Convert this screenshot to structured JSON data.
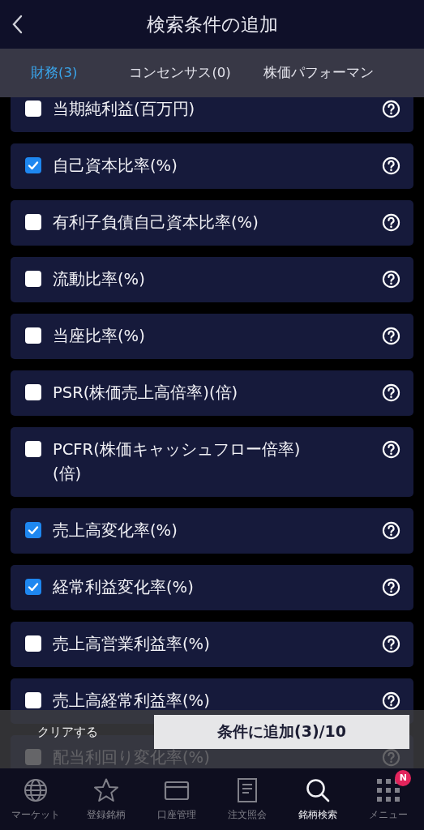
{
  "header": {
    "title": "検索条件の追加"
  },
  "tabs": [
    {
      "label": "財務(3)",
      "selected": true
    },
    {
      "label": "コンセンサス(0)",
      "selected": false
    },
    {
      "label": "株価パフォーマン",
      "selected": false
    }
  ],
  "conditions": [
    {
      "label": "当期純利益(百万円)",
      "checked": false
    },
    {
      "label": "自己資本比率(%)",
      "checked": true
    },
    {
      "label": "有利子負債自己資本比率(%)",
      "checked": false
    },
    {
      "label": "流動比率(%)",
      "checked": false
    },
    {
      "label": "当座比率(%)",
      "checked": false
    },
    {
      "label": "PSR(株価売上高倍率)(倍)",
      "checked": false
    },
    {
      "label": "PCFR(株価キャッシュフロー倍率)(倍)",
      "checked": false
    },
    {
      "label": "売上高変化率(%)",
      "checked": true
    },
    {
      "label": "経常利益変化率(%)",
      "checked": true
    },
    {
      "label": "売上高営業利益率(%)",
      "checked": false
    },
    {
      "label": "売上高経常利益率(%)",
      "checked": false
    },
    {
      "label": "配当利回り変化率(%)",
      "checked": false
    }
  ],
  "footer": {
    "clear_label": "クリアする",
    "add_label": "条件に追加(3)/10"
  },
  "nav": [
    {
      "label": "マーケット",
      "selected": false
    },
    {
      "label": "登録銘柄",
      "selected": false
    },
    {
      "label": "口座管理",
      "selected": false
    },
    {
      "label": "注文照会",
      "selected": false
    },
    {
      "label": "銘柄検索",
      "selected": true
    },
    {
      "label": "メニュー",
      "selected": false,
      "badge": "N"
    }
  ]
}
